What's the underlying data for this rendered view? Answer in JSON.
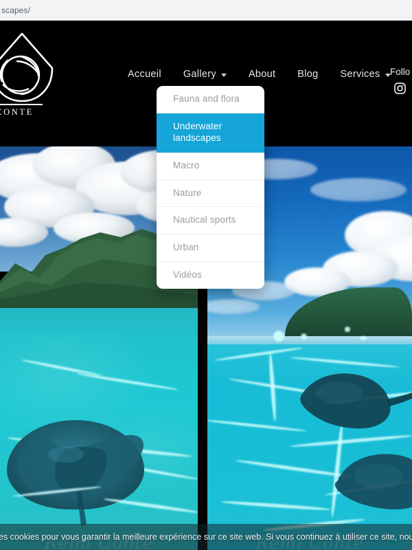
{
  "browser": {
    "url_fragment": "scapes/"
  },
  "header": {
    "logo": {
      "icon": "waterdrop-camera-aperture-logo",
      "name": "MI CONTE"
    },
    "nav": [
      {
        "label": "Accueil",
        "has_caret": false
      },
      {
        "label": "Gallery",
        "has_caret": true
      },
      {
        "label": "About",
        "has_caret": false
      },
      {
        "label": "Blog",
        "has_caret": false
      },
      {
        "label": "Services",
        "has_caret": true
      }
    ],
    "follow_label": "Follo",
    "social": {
      "icon": "instagram-icon"
    },
    "background_color": "#000000"
  },
  "dropdown": {
    "open_for": "Gallery",
    "active_color": "#15a5d8",
    "items": [
      {
        "label": "Fauna and flora",
        "active": false
      },
      {
        "label": "Underwater landscapes",
        "active": true
      },
      {
        "label": "Macro",
        "active": false
      },
      {
        "label": "Nature",
        "active": false
      },
      {
        "label": "Nautical sports",
        "active": false
      },
      {
        "label": "Urban",
        "active": false
      },
      {
        "label": "Vidéos",
        "active": false
      }
    ]
  },
  "gallery": {
    "tiles": [
      {
        "name": "photo-island-lagoon-stingray",
        "alt": "Split-level shot of a tropical island with green mountains, white clouds and a turquoise lagoon with a stingray on the sandy bottom",
        "watermark": "Rémi Conte"
      },
      {
        "name": "photo-lagoon-stingrays",
        "alt": "Blue sky with cumulus clouds over a green hillside and a shallow turquoise lagoon with stingrays and light caustics",
        "watermark": "Rémi Conte"
      }
    ]
  },
  "cookie_banner": {
    "text": "es cookies pour vous garantir la meilleure expérience sur ce site web. Si vous continuez à utiliser ce site, nous supposerons que vous en"
  }
}
